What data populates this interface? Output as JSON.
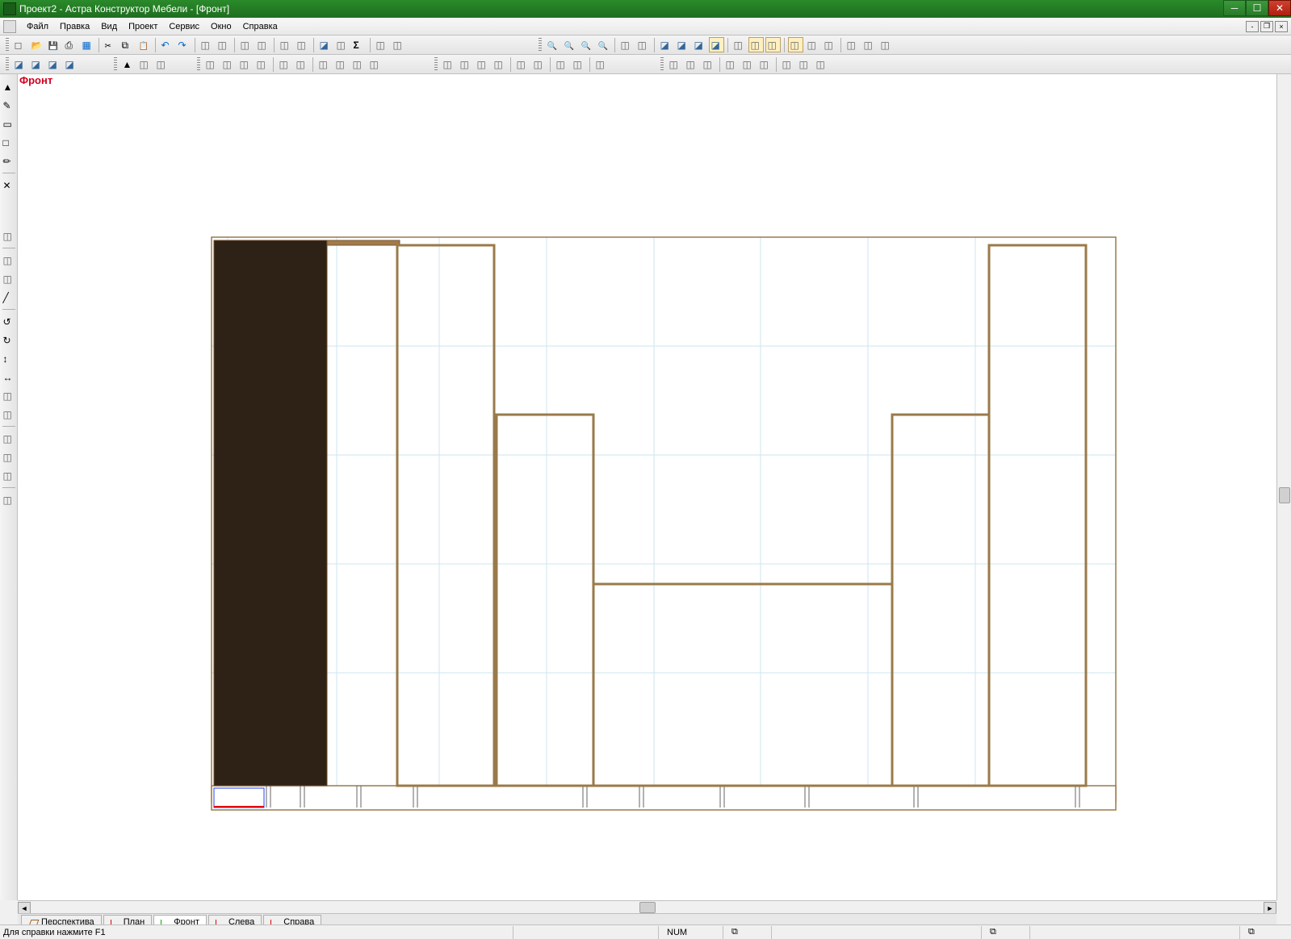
{
  "window": {
    "title": "Проект2 - Астра Конструктор Мебели - [Фронт]"
  },
  "menubar": {
    "items": [
      "Файл",
      "Правка",
      "Вид",
      "Проект",
      "Сервис",
      "Окно",
      "Справка"
    ]
  },
  "view": {
    "label": "Фронт"
  },
  "view_tabs": {
    "items": [
      {
        "label": "Перспектива",
        "active": false
      },
      {
        "label": "План",
        "active": false
      },
      {
        "label": "Фронт",
        "active": true
      },
      {
        "label": "Слева",
        "active": false
      },
      {
        "label": "Справа",
        "active": false
      }
    ]
  },
  "statusbar": {
    "help_text": "Для справки нажмите F1",
    "num_lock": "NUM"
  },
  "toolbar_icons": {
    "new": "Новый",
    "open": "Открыть",
    "save": "Сохранить",
    "print": "Печать",
    "preview": "Просмотр",
    "cut": "Вырезать",
    "copy": "Копировать",
    "paste": "Вставить",
    "undo": "Отменить",
    "redo": "Повторить",
    "sum": "Σ",
    "zoom_fit": "Показать все",
    "zoom_in": "Увеличить",
    "zoom_out": "Уменьшить"
  }
}
